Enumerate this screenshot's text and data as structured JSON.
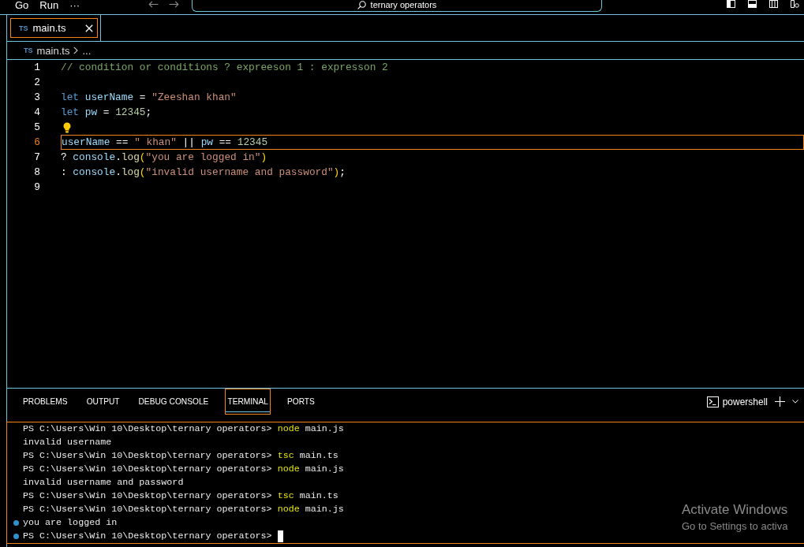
{
  "title_bar": {
    "menu": [
      "Go",
      "Run",
      "···"
    ],
    "search": "ternary operators"
  },
  "editor_tabs": [
    {
      "icon_text": "TS",
      "label": "main.ts",
      "selected": true
    }
  ],
  "breadcrumb": {
    "icon_text": "TS",
    "file": "main.ts",
    "rest": "..."
  },
  "code_lines": [
    {
      "number": "1",
      "current": false,
      "lightbulb": false,
      "tokens": [
        {
          "kind": "comment",
          "text": "// condition or conditions ? expreeson 1 : expresson 2"
        }
      ]
    },
    {
      "number": "2",
      "current": false,
      "lightbulb": false
    },
    {
      "number": "3",
      "current": false,
      "lightbulb": false,
      "tokens": [
        {
          "kind": "keyword",
          "text": "let "
        },
        {
          "kind": "variable",
          "text": "userName"
        },
        {
          "kind": "operator",
          "text": " = "
        },
        {
          "kind": "string",
          "text": "\"Zeeshan khan\""
        }
      ]
    },
    {
      "number": "4",
      "current": false,
      "lightbulb": false,
      "tokens": [
        {
          "kind": "keyword",
          "text": "let "
        },
        {
          "kind": "variable",
          "text": "pw"
        },
        {
          "kind": "operator",
          "text": " = "
        },
        {
          "kind": "number",
          "text": "12345"
        },
        {
          "kind": "operator",
          "text": ";"
        }
      ]
    },
    {
      "number": "5",
      "current": false,
      "lightbulb": true
    },
    {
      "number": "6",
      "current": true,
      "lightbulb": false,
      "tokens": [
        {
          "kind": "variable",
          "text": "userName"
        },
        {
          "kind": "operator",
          "text": " == "
        },
        {
          "kind": "string",
          "text": "\" khan\""
        },
        {
          "kind": "operator",
          "text": " || "
        },
        {
          "kind": "variable",
          "text": "pw"
        },
        {
          "kind": "operator",
          "text": " == "
        },
        {
          "kind": "number",
          "text": "12345"
        }
      ]
    },
    {
      "number": "7",
      "current": false,
      "lightbulb": false,
      "tokens": [
        {
          "kind": "operator",
          "text": "? "
        },
        {
          "kind": "variable",
          "text": "console"
        },
        {
          "kind": "operator",
          "text": "."
        },
        {
          "kind": "function",
          "text": "log"
        },
        {
          "kind": "bracket",
          "text": "("
        },
        {
          "kind": "string",
          "text": "\"you are logged in\""
        },
        {
          "kind": "bracket",
          "text": ")"
        }
      ]
    },
    {
      "number": "8",
      "current": false,
      "lightbulb": false,
      "tokens": [
        {
          "kind": "operator",
          "text": ": "
        },
        {
          "kind": "variable",
          "text": "console"
        },
        {
          "kind": "operator",
          "text": "."
        },
        {
          "kind": "function",
          "text": "log"
        },
        {
          "kind": "bracket",
          "text": "("
        },
        {
          "kind": "string",
          "text": "\"invalid username and password\""
        },
        {
          "kind": "bracket",
          "text": ")"
        },
        {
          "kind": "operator",
          "text": ";"
        }
      ]
    },
    {
      "number": "9",
      "current": false,
      "lightbulb": false
    }
  ],
  "panel": {
    "tabs": [
      {
        "label": "PROBLEMS",
        "selected": false
      },
      {
        "label": "OUTPUT",
        "selected": false
      },
      {
        "label": "DEBUG CONSOLE",
        "selected": false
      },
      {
        "label": "TERMINAL",
        "selected": true
      },
      {
        "label": "PORTS",
        "selected": false
      }
    ],
    "shell": "powershell"
  },
  "terminal": {
    "lines": [
      {
        "kind": "prompt",
        "prompt": "PS C:\\Users\\Win 10\\Desktop\\ternary operators>",
        "command": "node",
        "args": "main.js",
        "decorated": false,
        "cursor": false
      },
      {
        "kind": "output",
        "text": "invalid username",
        "decorated": false,
        "cursor": false
      },
      {
        "kind": "prompt",
        "prompt": "PS C:\\Users\\Win 10\\Desktop\\ternary operators>",
        "command": "tsc",
        "args": "main.ts",
        "decorated": false,
        "cursor": false
      },
      {
        "kind": "prompt",
        "prompt": "PS C:\\Users\\Win 10\\Desktop\\ternary operators>",
        "command": "node",
        "args": "main.js",
        "decorated": false,
        "cursor": false
      },
      {
        "kind": "output",
        "text": "invalid username and password",
        "decorated": false,
        "cursor": false
      },
      {
        "kind": "prompt",
        "prompt": "PS C:\\Users\\Win 10\\Desktop\\ternary operators>",
        "command": "tsc",
        "args": "main.ts",
        "decorated": false,
        "cursor": false
      },
      {
        "kind": "prompt",
        "prompt": "PS C:\\Users\\Win 10\\Desktop\\ternary operators>",
        "command": "node",
        "args": "main.js",
        "decorated": false,
        "cursor": false
      },
      {
        "kind": "output",
        "text": "you are logged in",
        "decorated": true,
        "cursor": false
      },
      {
        "kind": "prompt",
        "prompt": "PS C:\\Users\\Win 10\\Desktop\\ternary operators>",
        "decorated": true,
        "cursor": true
      }
    ]
  },
  "os_notice": {
    "title": "Activate Windows",
    "text": "Go to Settings to activa"
  }
}
